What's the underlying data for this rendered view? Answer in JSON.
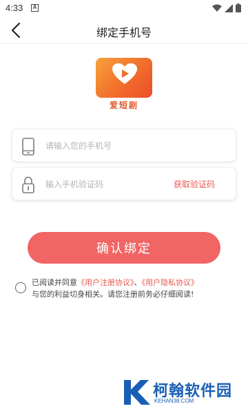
{
  "status_bar": {
    "time": "4:33",
    "notification_letter": "A"
  },
  "header": {
    "title": "绑定手机号"
  },
  "logo": {
    "text": "爱短剧",
    "brand_color": "#f16a2b"
  },
  "form": {
    "phone_placeholder": "请输入您的手机号",
    "phone_value": "",
    "code_placeholder": "输入手机验证码",
    "code_value": "",
    "get_code_label": "获取验证码"
  },
  "confirm_button": {
    "label": "确认绑定",
    "color": "#f26565"
  },
  "agreement": {
    "prefix": "已阅读并同意",
    "user_register": "《用户注册协议》",
    "separator": "、",
    "user_privacy": "《用户隐私协议》",
    "suffix": "与您的利益切身相关。请您注册前务必仔细阅读!",
    "checked": false,
    "link_color": "#e8574f"
  },
  "watermark": {
    "name": "柯翰软件园",
    "url": "KEHAN38.COM"
  }
}
